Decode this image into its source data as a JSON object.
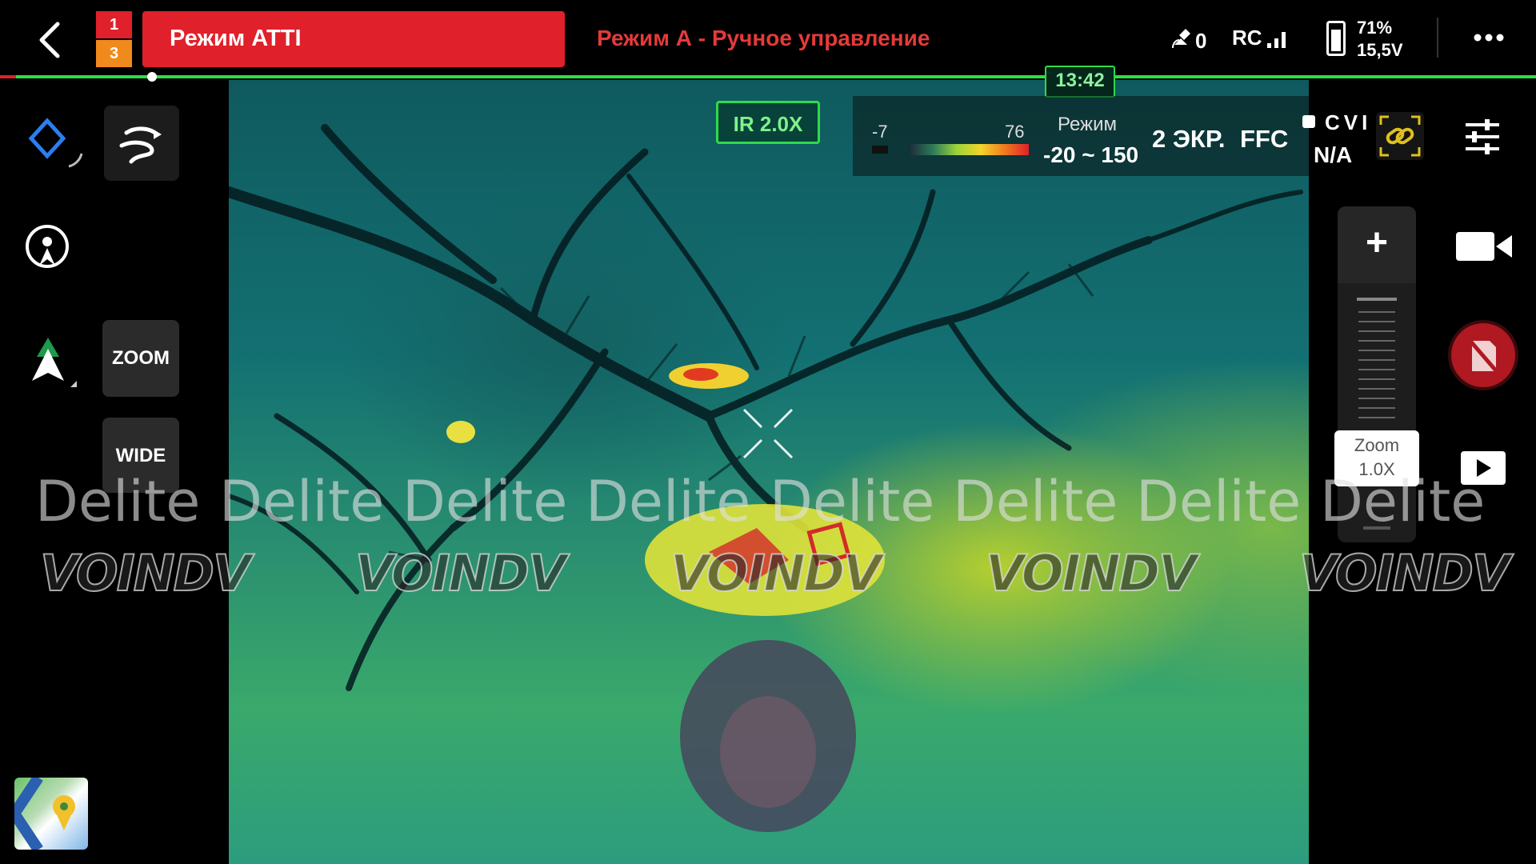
{
  "header": {
    "mode_badge_top": "1",
    "mode_badge_bottom": "3",
    "flight_mode": "Режим ATTI",
    "control_mode": "Режим А - Ручное управление",
    "satellite_count": "0",
    "rc_label": "RC",
    "battery_percent": "71%",
    "battery_voltage": "15,5V",
    "flight_time": "13:42",
    "accent_red": "#e0202a",
    "accent_orange": "#f08a1c",
    "accent_green": "#2edb4a"
  },
  "left_panel": {
    "zoom_button": "ZOOM",
    "wide_button": "WIDE",
    "icons": [
      "back-arrow-icon",
      "waypoint-diamond-icon",
      "flight-path-icon",
      "home-point-icon",
      "compass-arrow-icon",
      "map-thumbnail-icon"
    ]
  },
  "thermal": {
    "ir_zoom": "IR 2.0X",
    "scale_min": "-7",
    "scale_max": "76",
    "range_title": "Режим",
    "range_value": "-20 ~ 150",
    "screen_mode": "2 ЭКР.",
    "ffc": "FFC"
  },
  "right_panel": {
    "cvi_label": "CVI",
    "cvi_value": "N/A",
    "zoom_plus": "+",
    "zoom_tip_label": "Zoom",
    "zoom_tip_value": "1.0X",
    "icons": [
      "link-icon",
      "settings-sliders-icon",
      "video-camera-icon",
      "no-sd-card-icon",
      "playback-icon"
    ]
  },
  "watermarks": {
    "text": "Delite",
    "logo": "VOINDV"
  }
}
